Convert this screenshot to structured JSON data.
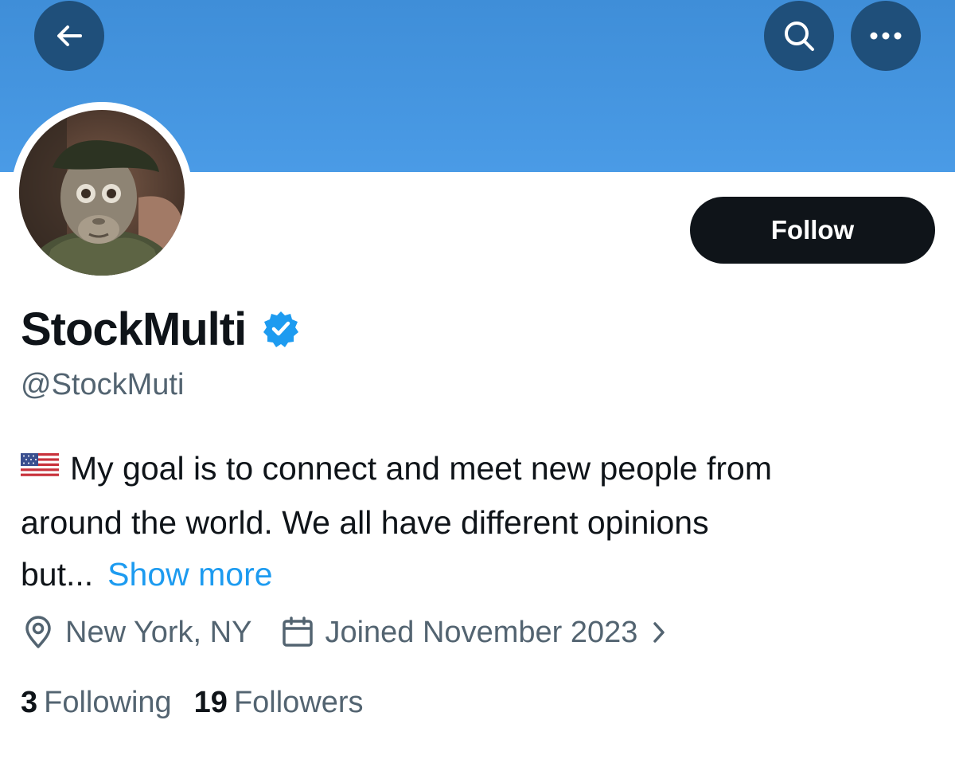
{
  "colors": {
    "banner": "#4a9be6",
    "nav_button": "#1f4f7a",
    "follow_button": "#0f1419",
    "link": "#1d9bf0",
    "secondary_text": "#536471",
    "verified_badge": "#1d9bf0"
  },
  "header": {
    "back_icon": "arrow-left-icon",
    "search_icon": "search-icon",
    "more_icon": "more-horizontal-icon"
  },
  "profile": {
    "display_name": "StockMulti",
    "verified": true,
    "handle": "@StockMuti",
    "follow_label": "Follow",
    "bio": {
      "flag_icon": "us-flag-emoji",
      "line1": "My goal is to connect and meet new people from",
      "line2": "around the world. We all have different opinions",
      "line3": "but...",
      "show_more": "Show more"
    },
    "location": "New York, NY",
    "joined": "Joined November 2023",
    "following_count": "3",
    "following_label": "Following",
    "followers_count": "19",
    "followers_label": "Followers"
  }
}
